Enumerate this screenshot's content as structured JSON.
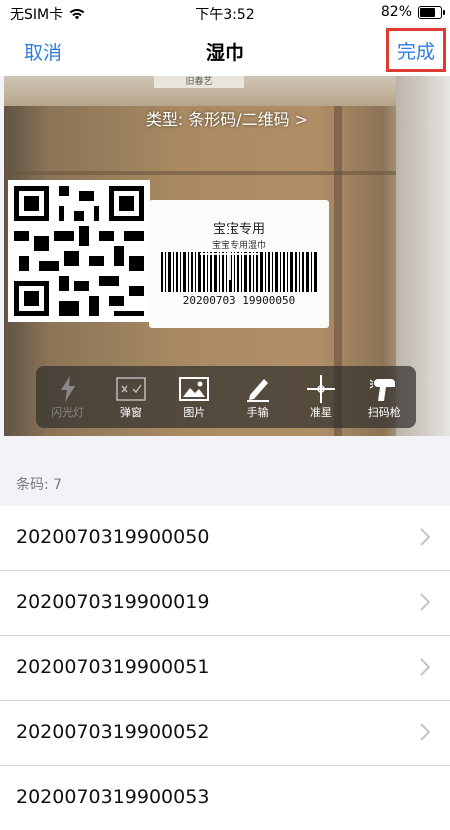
{
  "status_bar": {
    "carrier": "无SIM卡",
    "time": "下午3:52",
    "battery": "82%",
    "battery_level": 0.82
  },
  "nav": {
    "cancel_label": "取消",
    "title": "湿巾",
    "done_label": "完成"
  },
  "camera": {
    "scan_type": "类型: 条形码/二维码 >",
    "label_line1": "宝宝专用",
    "label_line2": "宝宝专用湿巾",
    "label_number": "20200703 19900050",
    "top_label": "旧春艺"
  },
  "toolbar": {
    "items": [
      {
        "label": "闪光灯",
        "icon": "flash-icon"
      },
      {
        "label": "弹窗",
        "icon": "popup-icon"
      },
      {
        "label": "图片",
        "icon": "image-icon"
      },
      {
        "label": "手输",
        "icon": "pen-icon"
      },
      {
        "label": "准星",
        "icon": "crosshair-icon"
      },
      {
        "label": "扫码枪",
        "icon": "scanner-gun-icon"
      }
    ]
  },
  "list": {
    "count_label": "条码: 7",
    "items": [
      "2020070319900050",
      "2020070319900019",
      "2020070319900051",
      "2020070319900052",
      "2020070319900053"
    ]
  },
  "colors": {
    "accent": "#2f7de1",
    "highlight_border": "#e03b30"
  }
}
